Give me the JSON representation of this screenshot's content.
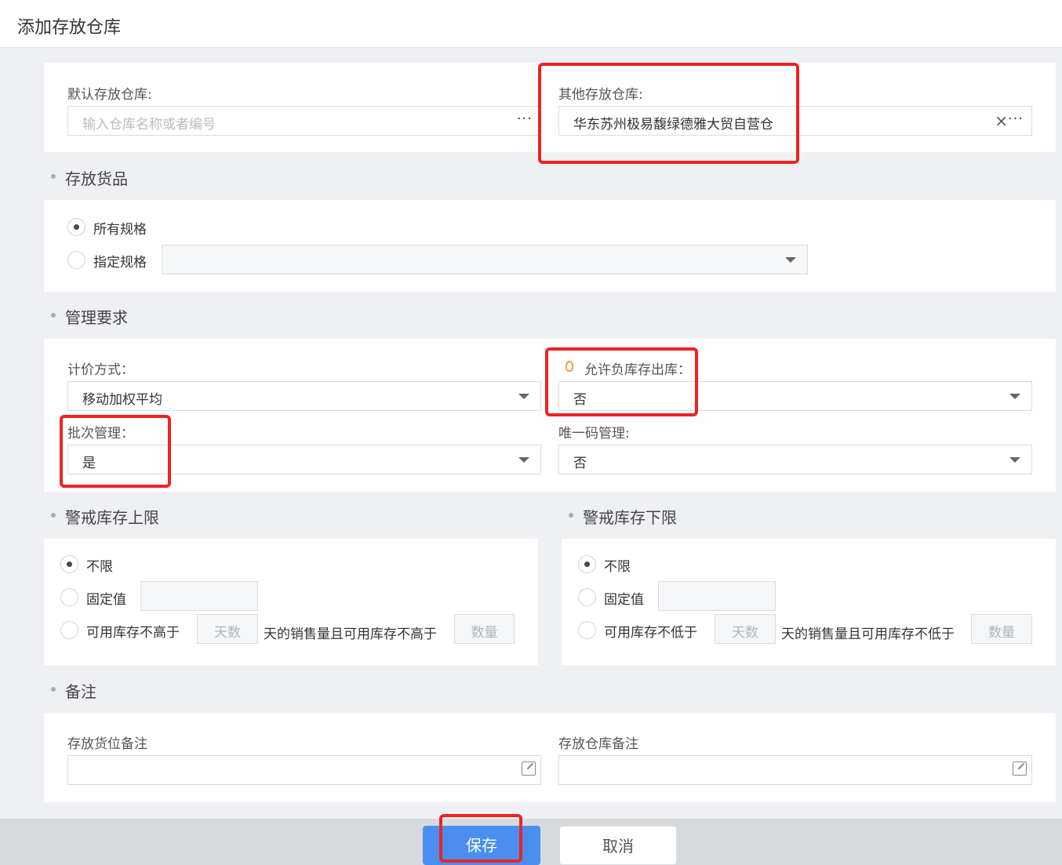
{
  "header": {
    "title": "添加存放仓库"
  },
  "warehouse": {
    "default_label": "默认存放仓库:",
    "default_placeholder": "输入仓库名称或者编号",
    "other_label": "其他存放仓库:",
    "other_value": "华东苏州极易馥绿德雅大贸自营仓",
    "dots": "···",
    "clear": "×"
  },
  "goods": {
    "section_title": "存放货品",
    "option_all": "所有规格",
    "option_specified": "指定规格",
    "selected": "所有规格"
  },
  "management": {
    "section_title": "管理要求",
    "pricing_label": "计价方式：",
    "pricing_value": "移动加权平均",
    "negative_label": "允许负库存出库：",
    "negative_value": "否",
    "batch_label": "批次管理：",
    "batch_value": "是",
    "unique_label": "唯一码管理:",
    "unique_value": "否"
  },
  "upper_limit": {
    "section_title": "警戒库存上限",
    "opt_unlimited": "不限",
    "opt_fixed": "固定值",
    "opt_avail": "可用库存不高于",
    "days_placeholder": "天数",
    "mid_text": "天的销售量且可用库存不高于",
    "qty_placeholder": "数量",
    "selected": "不限"
  },
  "lower_limit": {
    "section_title": "警戒库存下限",
    "opt_unlimited": "不限",
    "opt_fixed": "固定值",
    "opt_avail": "可用库存不低于",
    "days_placeholder": "天数",
    "mid_text": "天的销售量且可用库存不低于",
    "qty_placeholder": "数量",
    "selected": "不限"
  },
  "notes": {
    "section_title": "备注",
    "location_label": "存放货位备注",
    "warehouse_label": "存放仓库备注"
  },
  "footer": {
    "save": "保存",
    "cancel": "取消"
  },
  "colors": {
    "primary": "#4a8ff0",
    "highlight": "#ee2222",
    "background": "#eef0f3"
  }
}
